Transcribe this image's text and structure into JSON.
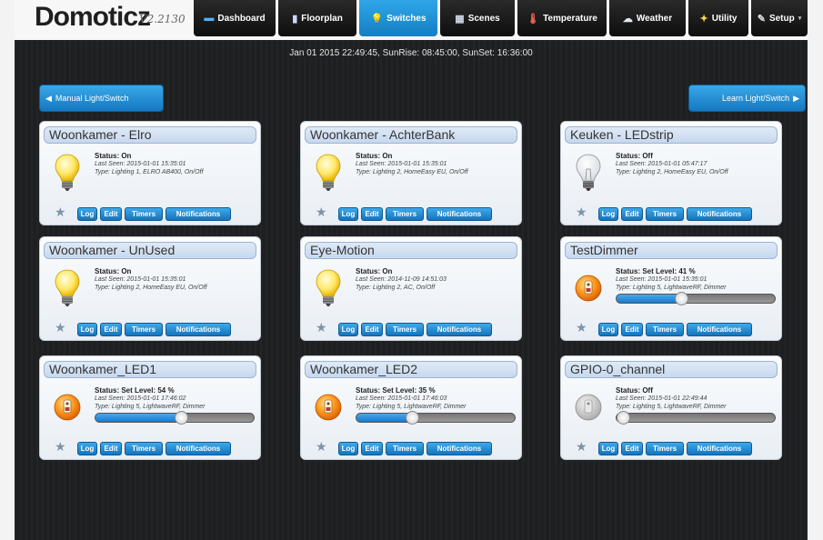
{
  "app": {
    "logo": "Domoticz",
    "version": "V2.2130"
  },
  "nav": {
    "tabs": [
      {
        "label": "Dashboard",
        "icon": "monitor-icon",
        "glyph": "▬"
      },
      {
        "label": "Floorplan",
        "icon": "floorplan-icon",
        "glyph": "▮"
      },
      {
        "label": "Switches",
        "icon": "bulb-icon",
        "glyph": "💡"
      },
      {
        "label": "Scenes",
        "icon": "scenes-icon",
        "glyph": "▦"
      },
      {
        "label": "Temperature",
        "icon": "thermometer-icon",
        "glyph": "🌡"
      },
      {
        "label": "Weather",
        "icon": "cloud-icon",
        "glyph": "☁"
      },
      {
        "label": "Utility",
        "icon": "leaf-icon",
        "glyph": "✦"
      },
      {
        "label": "Setup",
        "icon": "tools-icon",
        "glyph": "✎"
      }
    ]
  },
  "status_bar": {
    "datetime": "Jan 01 2015 22:49:45, SunRise: 08:45:00, SunSet: 16:36:00"
  },
  "actions": {
    "manual": "Manual Light/Switch",
    "learn": "Learn Light/Switch"
  },
  "card_buttons": {
    "log": "Log",
    "edit": "Edit",
    "timers": "Timers",
    "notifications": "Notifications"
  },
  "colors": {
    "accent": "#1e8fd6",
    "background": "#1e1f20"
  },
  "devices": [
    {
      "name": "Woonkamer - Elro",
      "status": "Status: On",
      "last_seen": "Last Seen: 2015-01-01 15:35:01",
      "type": "Type: Lighting 1, ELRO AB400, On/Off",
      "icon": "bulb-on-icon"
    },
    {
      "name": "Woonkamer - AchterBank",
      "status": "Status: On",
      "last_seen": "Last Seen: 2015-01-01 15:35:01",
      "type": "Type: Lighting 2, HomeEasy EU, On/Off",
      "icon": "bulb-on-icon"
    },
    {
      "name": "Keuken - LEDstrip",
      "status": "Status: Off",
      "last_seen": "Last Seen: 2015-01-01 05:47:17",
      "type": "Type: Lighting 2, HomeEasy EU, On/Off",
      "icon": "bulb-off-icon"
    },
    {
      "name": "Woonkamer - UnUsed",
      "status": "Status: On",
      "last_seen": "Last Seen: 2015-01-01 15:35:01",
      "type": "Type: Lighting 2, HomeEasy EU, On/Off",
      "icon": "bulb-on-icon"
    },
    {
      "name": "Eye-Motion",
      "status": "Status: On",
      "last_seen": "Last Seen: 2014-11-09 14:51:03",
      "type": "Type: Lighting 2, AC, On/Off",
      "icon": "bulb-on-icon"
    },
    {
      "name": "TestDimmer",
      "status": "Status: Set Level: 41 %",
      "last_seen": "Last Seen: 2015-01-01 15:35:01",
      "type": "Type: Lighting 5, LightwaveRF, Dimmer",
      "icon": "dimmer-on-icon",
      "level": 41
    },
    {
      "name": "Woonkamer_LED1",
      "status": "Status: Set Level: 54 %",
      "last_seen": "Last Seen: 2015-01-01 17:46:02",
      "type": "Type: Lighting 5, LightwaveRF, Dimmer",
      "icon": "dimmer-on-icon",
      "level": 54
    },
    {
      "name": "Woonkamer_LED2",
      "status": "Status: Set Level: 35 %",
      "last_seen": "Last Seen: 2015-01-01 17:46:03",
      "type": "Type: Lighting 5, LightwaveRF, Dimmer",
      "icon": "dimmer-on-icon",
      "level": 35
    },
    {
      "name": "GPIO-0_channel",
      "status": "Status: Off",
      "last_seen": "Last Seen: 2015-01-01 22:49:44",
      "type": "Type: Lighting 5, LightwaveRF, Dimmer",
      "icon": "dimmer-off-icon",
      "level": 0
    }
  ]
}
